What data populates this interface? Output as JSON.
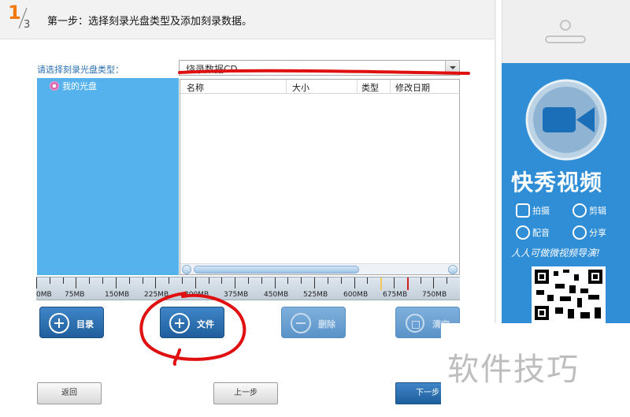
{
  "header": {
    "step_current": "1",
    "step_total": "3",
    "title": "第一步：选择刻录光盘类型及添加刻录数据。"
  },
  "disc_type": {
    "label": "请选择刻录光盘类型：",
    "selected": "烧录数据CD"
  },
  "tree": {
    "items": [
      {
        "label": "我的光盘",
        "icon": "disc-icon"
      }
    ]
  },
  "file_list": {
    "columns": [
      "名称",
      "大小",
      "类型",
      "修改日期"
    ],
    "rows": []
  },
  "capacity_ruler": {
    "labels": [
      "0MB",
      "75MB",
      "150MB",
      "225MB",
      "300MB",
      "375MB",
      "450MB",
      "525MB",
      "600MB",
      "675MB",
      "750MB"
    ],
    "markers": {
      "warning_mb": 650,
      "limit_mb": 700
    },
    "colors": {
      "warning": "#f1c75a",
      "limit": "#d22020"
    }
  },
  "actions": {
    "directory": "目录",
    "file": "文件",
    "delete": "删除",
    "clear": "清空"
  },
  "nav": {
    "back": "返回",
    "prev": "上一步",
    "next": "下一步"
  },
  "ad": {
    "title": "快秀视频",
    "features": [
      "拍摄",
      "剪辑",
      "配音",
      "分享"
    ],
    "slogan": "人人可做微视频导演!"
  },
  "watermark": "软件技巧",
  "colors": {
    "accent": "#2a6fb5",
    "button": "#2d72b5",
    "tree_bg": "#56b2ec",
    "annotation": "#e01010",
    "ad_bg": "#2f8ed6"
  }
}
